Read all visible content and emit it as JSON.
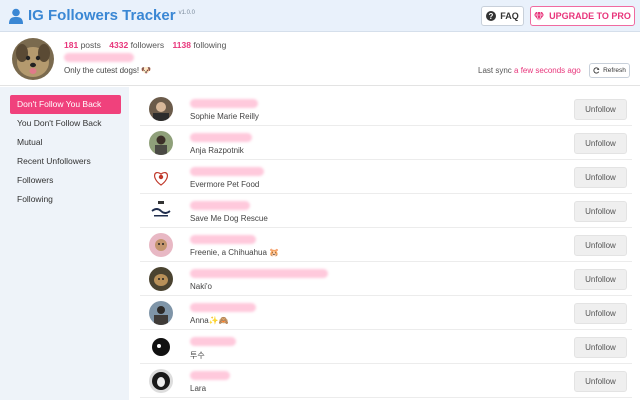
{
  "header": {
    "title": "IG Followers Tracker",
    "version": "v1.0.0",
    "faq_label": "FAQ",
    "upgrade_label": "UPGRADE TO PRO",
    "accent": "#3a87d4",
    "pink": "#e8357b"
  },
  "profile": {
    "posts_count": "181",
    "posts_label": "posts",
    "followers_count": "4332",
    "followers_label": "followers",
    "following_count": "1138",
    "following_label": "following",
    "bio": "Only the cutest dogs! 🐶",
    "sync_label": "Last sync",
    "sync_time": "a few seconds ago",
    "refresh_label": "Refresh"
  },
  "sidebar": {
    "items": [
      {
        "label": "Don't Follow You Back",
        "active": true
      },
      {
        "label": "You Don't Follow Back",
        "active": false
      },
      {
        "label": "Mutual",
        "active": false
      },
      {
        "label": "Recent Unfollowers",
        "active": false
      },
      {
        "label": "Followers",
        "active": false
      },
      {
        "label": "Following",
        "active": false
      }
    ]
  },
  "list": {
    "unfollow_label": "Unfollow",
    "rows": [
      {
        "name": "Sophie Marie Reilly"
      },
      {
        "name": "Anja Razpotnik"
      },
      {
        "name": "Evermore Pet Food"
      },
      {
        "name": "Save Me Dog Rescue"
      },
      {
        "name": "Freenie, a Chihuahua 🐹"
      },
      {
        "name": "Naki'o"
      },
      {
        "name": "Anna✨🙈"
      },
      {
        "name": "투수"
      },
      {
        "name": "Lara"
      }
    ]
  }
}
